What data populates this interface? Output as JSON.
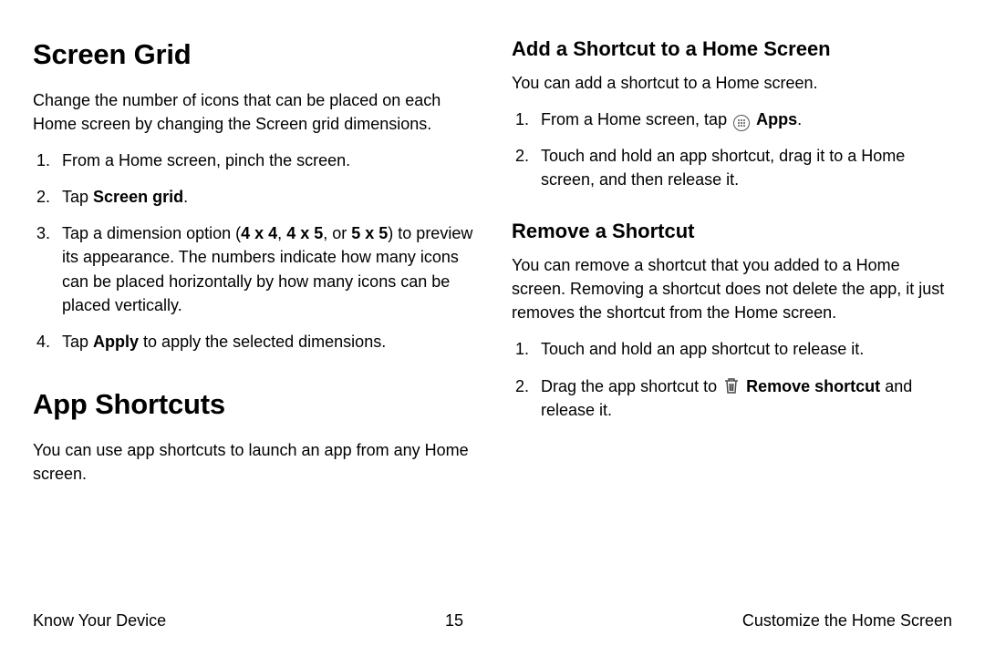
{
  "left": {
    "screenGrid": {
      "heading": "Screen Grid",
      "intro": "Change the number of icons that can be placed on each Home screen by changing the Screen grid dimensions.",
      "steps": {
        "s1": "From a Home screen, pinch the screen.",
        "s2_pre": "Tap ",
        "s2_bold": "Screen grid",
        "s2_post": ".",
        "s3_pre": "Tap a dimension option (",
        "s3_b1": "4 x 4",
        "s3_m1": ", ",
        "s3_b2": "4 x 5",
        "s3_m2": ", or ",
        "s3_b3": "5 x 5",
        "s3_post": ") to preview its appearance. The numbers indicate how many icons can be placed horizontally by how many icons can be placed vertically.",
        "s4_pre": "Tap ",
        "s4_bold": "Apply",
        "s4_post": " to apply the selected dimensions."
      }
    },
    "appShortcuts": {
      "heading": "App Shortcuts",
      "intro": "You can use app shortcuts to launch an app from any Home screen."
    }
  },
  "right": {
    "addShortcut": {
      "heading": "Add a Shortcut to a Home Screen",
      "intro": "You can add a shortcut to a Home screen.",
      "steps": {
        "s1_pre": "From a Home screen, tap ",
        "s1_bold": "Apps",
        "s1_post": ".",
        "s2": "Touch and hold an app shortcut, drag it to a Home screen, and then release it."
      }
    },
    "removeShortcut": {
      "heading": "Remove a Shortcut",
      "intro": "You can remove a shortcut that you added to a Home screen. Removing a shortcut does not delete the app, it just removes the shortcut from the Home screen.",
      "steps": {
        "s1": "Touch and hold an app shortcut to release it.",
        "s2_pre": "Drag the app shortcut to ",
        "s2_bold": "Remove shortcut",
        "s2_post": " and release it."
      }
    }
  },
  "footer": {
    "left": "Know Your Device",
    "center": "15",
    "right": "Customize the Home Screen"
  }
}
